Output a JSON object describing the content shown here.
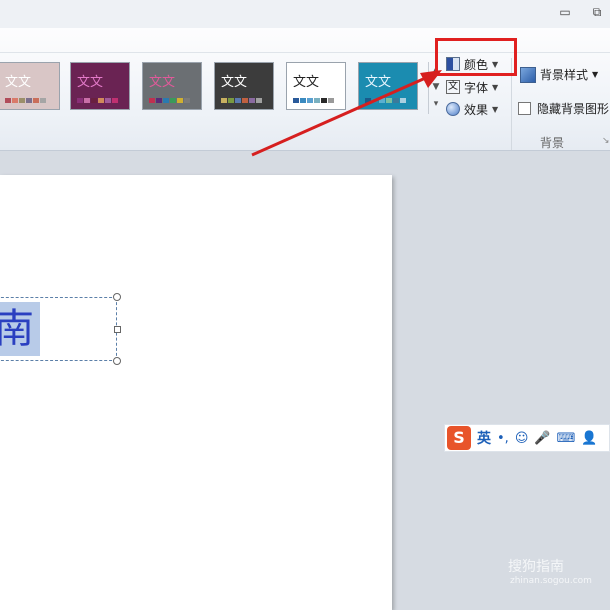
{
  "window": {
    "minimize_glyph": "▭",
    "restore_glyph": "⧉"
  },
  "themes": [
    {
      "sample": "文文",
      "bg": "#d9c6c6",
      "text_color": "#ffffff"
    },
    {
      "sample": "文文",
      "bg": "#6a2353",
      "text_color": "#e27ac8"
    },
    {
      "sample": "文文",
      "bg": "#6b6f73",
      "text_color": "#e05a9a"
    },
    {
      "sample": "文文",
      "bg": "#3c3c3c",
      "text_color": "#ffffff"
    },
    {
      "sample": "文文",
      "bg": "#ffffff",
      "text_color": "#222222"
    },
    {
      "sample": "文文",
      "bg": "#1b8cb0",
      "text_color": "#e8f6ff"
    }
  ],
  "gallery_scroll": {
    "up": "▲",
    "down": "▼",
    "more": "▾"
  },
  "commands": {
    "colors": "颜色",
    "fonts": "字体",
    "effects": "效果"
  },
  "background": {
    "style_label": "背景样式",
    "hide_label": "隐藏背景图形",
    "group_label": "背景",
    "launcher": "↘"
  },
  "slide": {
    "selected_text": "南"
  },
  "ime": {
    "logo": "S",
    "mode": "英",
    "punct": "•,",
    "emoji": "☺",
    "mic": "🎤",
    "keyboard": "⌨",
    "user": "👤"
  },
  "watermark": {
    "brand": "搜狗指南",
    "url": "zhinan.sogou.com"
  },
  "colors": {
    "highlight": "#e02020",
    "arrow": "#d61f1f"
  }
}
